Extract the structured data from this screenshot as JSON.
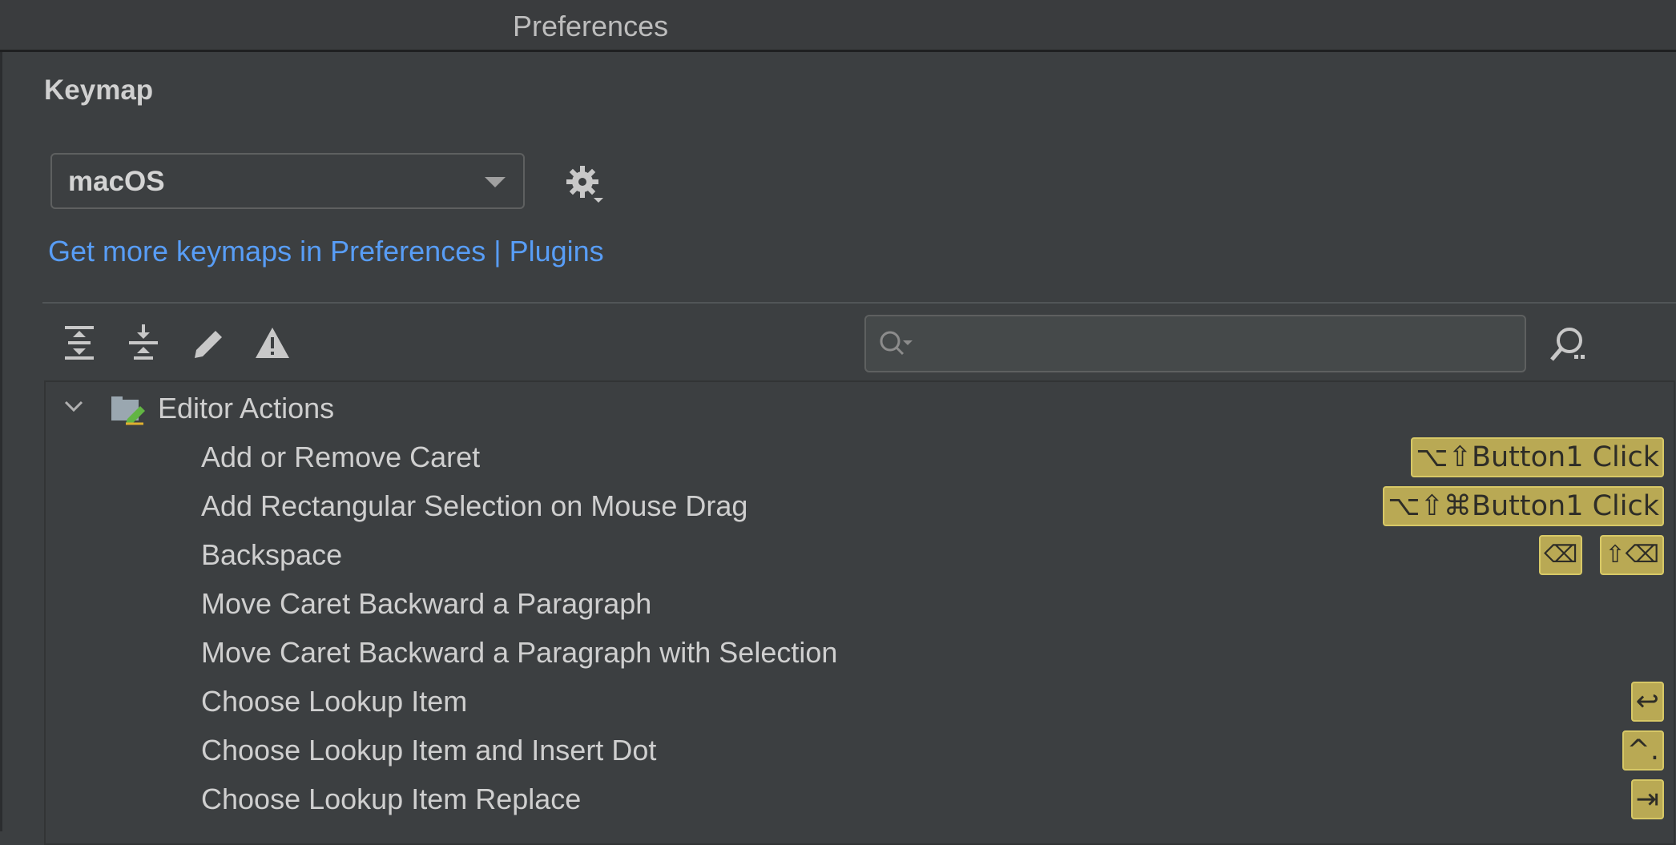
{
  "window": {
    "title": "Preferences"
  },
  "keymap": {
    "heading": "Keymap",
    "selected": "macOS",
    "link_text": "Get more keymaps in Preferences | Plugins"
  },
  "toolbar": {
    "icons": [
      "expand-all-icon",
      "collapse-all-icon",
      "edit-icon",
      "conflicts-warning-icon"
    ]
  },
  "search": {
    "value": "",
    "placeholder": ""
  },
  "tree": {
    "group": {
      "label": "Editor Actions",
      "expanded": true
    },
    "rows": [
      {
        "label": "Add or Remove Caret",
        "shortcuts": [
          "⌥⇧Button1 Click"
        ]
      },
      {
        "label": "Add Rectangular Selection on Mouse Drag",
        "shortcuts": [
          "⌥⇧⌘Button1 Click"
        ]
      },
      {
        "label": "Backspace",
        "shortcuts": [
          "⌫",
          "⇧⌫"
        ]
      },
      {
        "label": "Move Caret Backward a Paragraph",
        "shortcuts": []
      },
      {
        "label": "Move Caret Backward a Paragraph with Selection",
        "shortcuts": []
      },
      {
        "label": "Choose Lookup Item",
        "shortcuts": [
          "↩"
        ]
      },
      {
        "label": "Choose Lookup Item and Insert Dot",
        "shortcuts": [
          "^."
        ]
      },
      {
        "label": "Choose Lookup Item Replace",
        "shortcuts": [
          "⇥"
        ]
      }
    ]
  },
  "colors": {
    "background": "#3c3f41",
    "link": "#589df6",
    "shortcut_badge": "#b9a954"
  }
}
